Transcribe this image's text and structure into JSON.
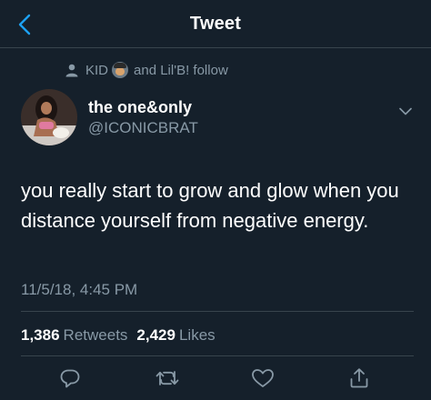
{
  "header": {
    "title": "Tweet",
    "back_icon": "chevron-left-icon"
  },
  "social_context": {
    "icon": "person-icon",
    "name_1": "KID",
    "emoji_icon": "person-emoji-icon",
    "text": "and Lil'B! follow"
  },
  "tweet": {
    "author_name": "the one&only",
    "author_handle": "@ICONICBRAT",
    "text": "you really start to grow and glow when you distance yourself from negative energy.",
    "timestamp": "11/5/18, 4:45 PM",
    "retweets_count": "1,386",
    "retweets_label": "Retweets",
    "likes_count": "2,429",
    "likes_label": "Likes"
  },
  "actions": [
    "reply-icon",
    "retweet-icon",
    "like-icon",
    "share-icon"
  ],
  "colors": {
    "background": "#15202b",
    "secondary_text": "#8899a6",
    "accent": "#1da1f2",
    "divider": "#38444d"
  }
}
